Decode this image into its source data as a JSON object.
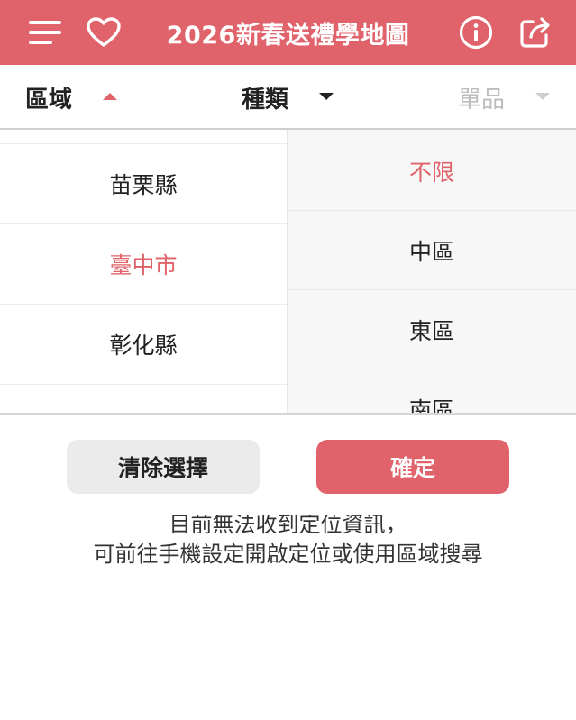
{
  "header": {
    "title": "2026新春送禮學地圖",
    "icons": {
      "menu": "menu-icon",
      "favorite": "heart-icon",
      "info": "info-icon",
      "share": "share-icon"
    },
    "background_color": "#e0626a"
  },
  "filters": {
    "region": {
      "label": "區域",
      "state": "expanded"
    },
    "category": {
      "label": "種類",
      "state": "collapsed"
    },
    "item": {
      "label": "單品",
      "state": "disabled"
    }
  },
  "region_list": {
    "items": [
      {
        "label": "苗栗縣",
        "active": false
      },
      {
        "label": "臺中市",
        "active": true
      },
      {
        "label": "彰化縣",
        "active": false
      }
    ]
  },
  "district_list": {
    "items": [
      {
        "label": "不限",
        "active": true
      },
      {
        "label": "中區",
        "active": false
      },
      {
        "label": "東區",
        "active": false
      },
      {
        "label": "南區",
        "active": false
      }
    ]
  },
  "actions": {
    "clear_label": "清除選擇",
    "confirm_label": "確定"
  },
  "message": {
    "line1": "目前無法收到定位資訊，",
    "line2": "可前往手機設定開啟定位或使用區域搜尋"
  },
  "colors": {
    "accent": "#e0626a",
    "muted": "#bdbdbd"
  }
}
